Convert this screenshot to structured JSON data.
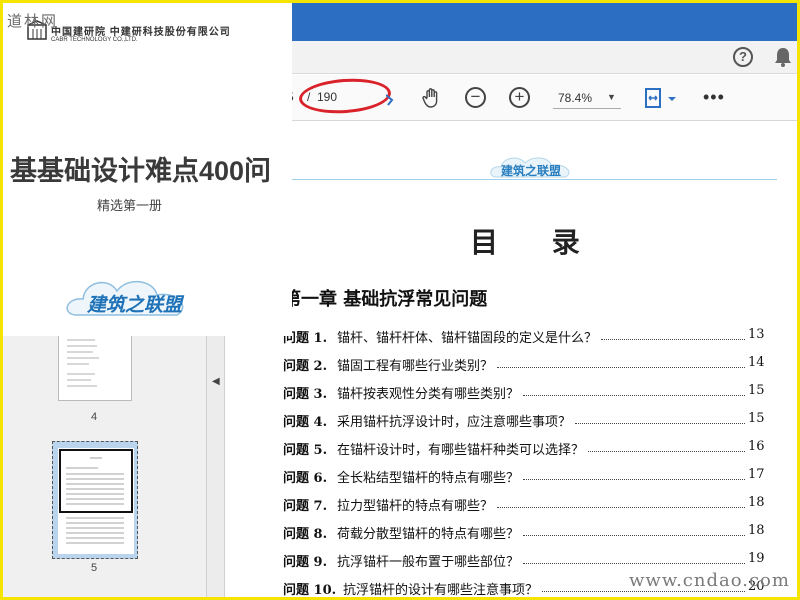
{
  "watermark_top": "道林网",
  "watermark_bottom": "www.cndao.com",
  "window": {
    "title_fragment": "t)"
  },
  "menubar": {
    "help_icon": "help-icon",
    "bell_icon": "bell-icon"
  },
  "toolbar": {
    "page_current": "5",
    "page_separator": "/",
    "page_total": "190",
    "zoom": "78.4%",
    "more": "•••"
  },
  "cover": {
    "org_line1": "中国建研院 中建研科技股份有限公司",
    "org_line2": "CABR TECHNOLOGY CO.,LTD.",
    "title": "基基础设计难点400问",
    "subtitle": "精选第一册"
  },
  "sidebar": {
    "thumbnails": [
      {
        "label": "4",
        "selected": false
      },
      {
        "label": "5",
        "selected": true
      }
    ]
  },
  "document": {
    "toc_heading": "目 录",
    "chapter": "第一章  基础抗浮常见问题",
    "entries": [
      {
        "num": "问题 1.",
        "question": "锚杆、锚杆杆体、锚杆锚固段的定义是什么？",
        "page": "13"
      },
      {
        "num": "问题 2.",
        "question": "锚固工程有哪些行业类别？",
        "page": "14"
      },
      {
        "num": "问题 3.",
        "question": "锚杆按表观性分类有哪些类别？",
        "page": "15"
      },
      {
        "num": "问题 4.",
        "question": "采用锚杆抗浮设计时，应注意哪些事项？",
        "page": "15"
      },
      {
        "num": "问题 5.",
        "question": "在锚杆设计时，有哪些锚杆种类可以选择？",
        "page": "16"
      },
      {
        "num": "问题 6.",
        "question": "全长粘结型锚杆的特点有哪些？",
        "page": "17"
      },
      {
        "num": "问题 7.",
        "question": "拉力型锚杆的特点有哪些？",
        "page": "18"
      },
      {
        "num": "问题 8.",
        "question": "荷载分散型锚杆的特点有哪些？",
        "page": "18"
      },
      {
        "num": "问题 9.",
        "question": "抗浮锚杆一般布置于哪些部位？",
        "page": "19"
      },
      {
        "num": "问题 10.",
        "question": "抗浮锚杆的设计有哪些注意事项？",
        "page": "20"
      }
    ]
  }
}
